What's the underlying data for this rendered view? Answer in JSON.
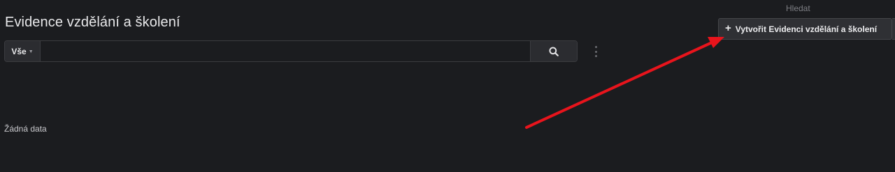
{
  "header": {
    "title": "Evidence vzdělání a školení",
    "search_label": "Hledat",
    "create_button_label": "Vytvořit Evidenci vzdělání a školení",
    "create_button_icon": "plus-icon"
  },
  "search": {
    "filter_value": "Vše",
    "filter_icon": "caret-down-icon",
    "input_value": "",
    "input_placeholder": "",
    "button_icon": "search-icon"
  },
  "toolbar": {
    "more_icon": "vertical-ellipsis-icon"
  },
  "main": {
    "empty_text": "Žádná data"
  },
  "annotation": {
    "arrow_color": "#e8141c"
  },
  "colors": {
    "background": "#1b1c1f",
    "surface": "#2b2c30",
    "border": "#3b3c40",
    "text": "#e8e8ea"
  }
}
